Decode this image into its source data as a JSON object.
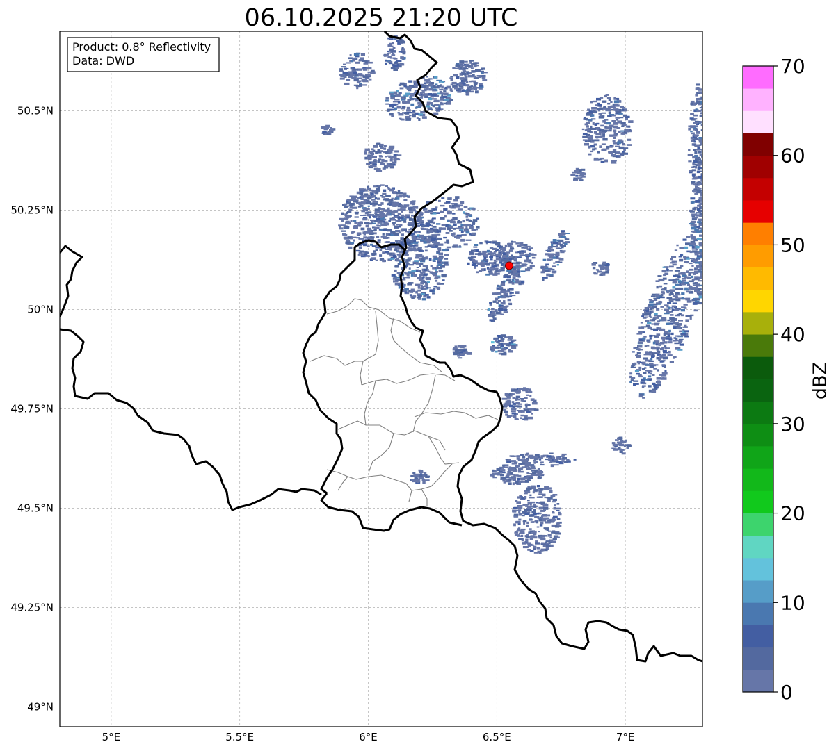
{
  "title": "06.10.2025 21:20 UTC",
  "info_box": {
    "product": "Product: 0.8° Reflectivity",
    "data": "Data: DWD"
  },
  "map": {
    "lon_range": [
      4.8,
      7.3
    ],
    "lat_range": [
      48.95,
      50.7
    ],
    "lon_ticks": [
      {
        "value": 5.0,
        "label": "5°E"
      },
      {
        "value": 5.5,
        "label": "5.5°E"
      },
      {
        "value": 6.0,
        "label": "6°E"
      },
      {
        "value": 6.5,
        "label": "6.5°E"
      },
      {
        "value": 7.0,
        "label": "7°E"
      }
    ],
    "lat_ticks": [
      {
        "value": 49.0,
        "label": "49°N"
      },
      {
        "value": 49.25,
        "label": "49.25°N"
      },
      {
        "value": 49.5,
        "label": "49.5°N"
      },
      {
        "value": 49.75,
        "label": "49.75°N"
      },
      {
        "value": 50.0,
        "label": "50°N"
      },
      {
        "value": 50.25,
        "label": "50.25°N"
      },
      {
        "value": 50.5,
        "label": "50.5°N"
      }
    ],
    "gridlines": true,
    "radar_site": {
      "lon": 6.548,
      "lat": 50.11,
      "color": "#ff0000"
    }
  },
  "colorbar": {
    "label": "dBZ",
    "min": 0,
    "max": 70,
    "step": 2.5,
    "ticks": [
      {
        "value": 0,
        "label": "0"
      },
      {
        "value": 10,
        "label": "10"
      },
      {
        "value": 20,
        "label": "20"
      },
      {
        "value": 30,
        "label": "30"
      },
      {
        "value": 40,
        "label": "40"
      },
      {
        "value": 50,
        "label": "50"
      },
      {
        "value": 60,
        "label": "60"
      },
      {
        "value": 70,
        "label": "70"
      }
    ],
    "colors": [
      "#6676a8",
      "#53699f",
      "#435ea2",
      "#4a78b0",
      "#569dc8",
      "#63c2dc",
      "#60d6c2",
      "#3dd46d",
      "#11c91c",
      "#12b81a",
      "#10a518",
      "#0e8e14",
      "#0c7a12",
      "#0a6410",
      "#0b5b0c",
      "#4a7a0a",
      "#a8b00b",
      "#ffd600",
      "#ffba00",
      "#ff9c00",
      "#ff7f00",
      "#e60000",
      "#c40000",
      "#a00000",
      "#800000",
      "#ffe0ff",
      "#ffb2ff",
      "#ff6cff",
      "#e83ae8"
    ]
  }
}
